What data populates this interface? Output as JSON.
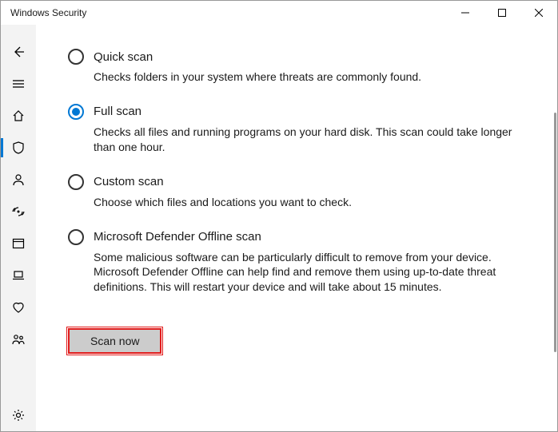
{
  "titlebar": {
    "title": "Windows Security"
  },
  "options": {
    "quick": {
      "title": "Quick scan",
      "desc": "Checks folders in your system where threats are commonly found."
    },
    "full": {
      "title": "Full scan",
      "desc": "Checks all files and running programs on your hard disk. This scan could take longer than one hour."
    },
    "custom": {
      "title": "Custom scan",
      "desc": "Choose which files and locations you want to check."
    },
    "offline": {
      "title": "Microsoft Defender Offline scan",
      "desc": "Some malicious software can be particularly difficult to remove from your device. Microsoft Defender Offline can help find and remove them using up-to-date threat definitions. This will restart your device and will take about 15 minutes."
    }
  },
  "actions": {
    "scan_now": "Scan now"
  }
}
